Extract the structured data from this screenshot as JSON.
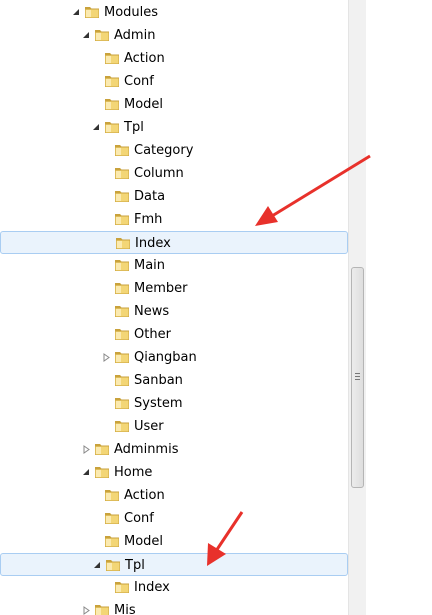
{
  "tree": {
    "items": [
      {
        "label": "Modules",
        "depth": 0,
        "expander": "expanded",
        "selected": false
      },
      {
        "label": "Admin",
        "depth": 1,
        "expander": "expanded",
        "selected": false
      },
      {
        "label": "Action",
        "depth": 2,
        "expander": "none",
        "selected": false
      },
      {
        "label": "Conf",
        "depth": 2,
        "expander": "none",
        "selected": false
      },
      {
        "label": "Model",
        "depth": 2,
        "expander": "none",
        "selected": false
      },
      {
        "label": "Tpl",
        "depth": 2,
        "expander": "expanded",
        "selected": false
      },
      {
        "label": "Category",
        "depth": 3,
        "expander": "none",
        "selected": false
      },
      {
        "label": "Column",
        "depth": 3,
        "expander": "none",
        "selected": false
      },
      {
        "label": "Data",
        "depth": 3,
        "expander": "none",
        "selected": false
      },
      {
        "label": "Fmh",
        "depth": 3,
        "expander": "none",
        "selected": false
      },
      {
        "label": "Index",
        "depth": 3,
        "expander": "none",
        "selected": true
      },
      {
        "label": "Main",
        "depth": 3,
        "expander": "none",
        "selected": false
      },
      {
        "label": "Member",
        "depth": 3,
        "expander": "none",
        "selected": false
      },
      {
        "label": "News",
        "depth": 3,
        "expander": "none",
        "selected": false
      },
      {
        "label": "Other",
        "depth": 3,
        "expander": "none",
        "selected": false
      },
      {
        "label": "Qiangban",
        "depth": 3,
        "expander": "collapsed",
        "selected": false
      },
      {
        "label": "Sanban",
        "depth": 3,
        "expander": "none",
        "selected": false
      },
      {
        "label": "System",
        "depth": 3,
        "expander": "none",
        "selected": false
      },
      {
        "label": "User",
        "depth": 3,
        "expander": "none",
        "selected": false
      },
      {
        "label": "Adminmis",
        "depth": 1,
        "expander": "collapsed",
        "selected": false
      },
      {
        "label": "Home",
        "depth": 1,
        "expander": "expanded",
        "selected": false
      },
      {
        "label": "Action",
        "depth": 2,
        "expander": "none",
        "selected": false
      },
      {
        "label": "Conf",
        "depth": 2,
        "expander": "none",
        "selected": false
      },
      {
        "label": "Model",
        "depth": 2,
        "expander": "none",
        "selected": false
      },
      {
        "label": "Tpl",
        "depth": 2,
        "expander": "expanded",
        "selected": true
      },
      {
        "label": "Index",
        "depth": 3,
        "expander": "none",
        "selected": false
      },
      {
        "label": "Mis",
        "depth": 1,
        "expander": "collapsed",
        "selected": false
      }
    ]
  },
  "colors": {
    "annotation_arrow": "#e8312b",
    "folder_fill": "#f3d676",
    "folder_edge": "#c9a23c",
    "selection_fill": "#eaf3fc",
    "selection_border": "#a9cdf2"
  },
  "icons": {
    "folder": "folder-icon",
    "expanded": "expanded-triangle-icon",
    "collapsed": "collapsed-triangle-icon"
  }
}
